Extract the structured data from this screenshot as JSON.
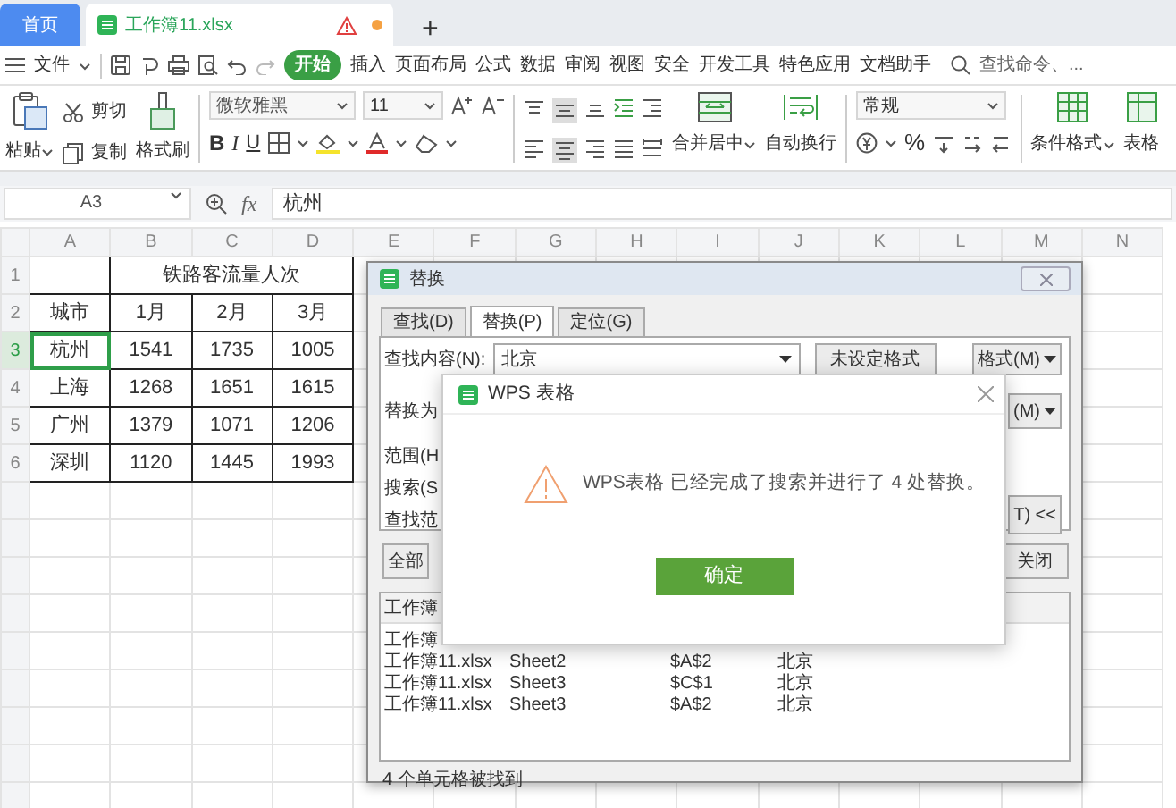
{
  "tabs": [
    {
      "label": "首页",
      "kind": "home",
      "selected": false
    },
    {
      "label": "工作簿11.xlsx",
      "kind": "document",
      "selected": true,
      "unsaved": true
    }
  ],
  "new_tab_label": "+",
  "menu": {
    "file": "文件",
    "items": [
      {
        "label": "开始",
        "selected": true
      },
      {
        "label": "插入",
        "selected": false
      },
      {
        "label": "页面布局",
        "selected": false
      },
      {
        "label": "公式",
        "selected": false
      },
      {
        "label": "数据",
        "selected": false
      },
      {
        "label": "审阅",
        "selected": false
      },
      {
        "label": "视图",
        "selected": false
      },
      {
        "label": "安全",
        "selected": false
      },
      {
        "label": "开发工具",
        "selected": false
      },
      {
        "label": "特色应用",
        "selected": false
      },
      {
        "label": "文档助手",
        "selected": false
      }
    ],
    "search_label": "查找命令、..."
  },
  "ribbon": {
    "paste": "粘贴",
    "cut": "剪切",
    "copy": "复制",
    "format_painter": "格式刷",
    "font_name": "微软雅黑",
    "font_size": "11",
    "bold": "B",
    "italic": "I",
    "underline": "U",
    "merge": "合并居中",
    "wrap": "自动换行",
    "number_format": "常规",
    "percent": "%",
    "conditional_format": "条件格式",
    "table_format": "表格"
  },
  "formula_bar": {
    "name_box": "A3",
    "fx": "fx",
    "value": "杭州"
  },
  "sheet": {
    "columns": [
      "A",
      "B",
      "C",
      "D",
      "E",
      "F",
      "G",
      "H",
      "I",
      "J",
      "K",
      "L",
      "M",
      "N"
    ],
    "row_numbers": [
      "1",
      "2",
      "3",
      "4",
      "5",
      "6"
    ],
    "title": "铁路客流量人次",
    "header": [
      "城市",
      "1月",
      "2月",
      "3月"
    ],
    "rows": [
      {
        "cells": [
          {
            "text": "杭州",
            "selected": true
          },
          {
            "text": "1541",
            "selected": false
          },
          {
            "text": "1735",
            "selected": false
          },
          {
            "text": "1005",
            "selected": false
          }
        ]
      },
      {
        "cells": [
          {
            "text": "上海",
            "selected": false
          },
          {
            "text": "1268",
            "selected": false
          },
          {
            "text": "1651",
            "selected": false
          },
          {
            "text": "1615",
            "selected": false
          }
        ]
      },
      {
        "cells": [
          {
            "text": "广州",
            "selected": false
          },
          {
            "text": "1379",
            "selected": false
          },
          {
            "text": "1071",
            "selected": false
          },
          {
            "text": "1206",
            "selected": false
          }
        ]
      },
      {
        "cells": [
          {
            "text": "深圳",
            "selected": false
          },
          {
            "text": "1120",
            "selected": false
          },
          {
            "text": "1445",
            "selected": false
          },
          {
            "text": "1993",
            "selected": false
          }
        ]
      }
    ]
  },
  "find_dialog": {
    "title": "替换",
    "tabs": [
      {
        "label": "查找(D)",
        "selected": false
      },
      {
        "label": "替换(P)",
        "selected": true
      },
      {
        "label": "定位(G)",
        "selected": false
      }
    ],
    "find_label": "查找内容(N):",
    "find_value": "北京",
    "no_format_button": "未设定格式",
    "format_button": "格式(M)",
    "replace_label": "替换为",
    "replace_format_button": "(M)",
    "options": [
      "范围(H",
      "搜索(S",
      "查找范"
    ],
    "options_button": "T) <<",
    "replace_all_button": "全部",
    "close_button": "关闭",
    "results_header": "工作簿",
    "results": [
      [
        "工作簿"
      ],
      [
        "工作簿11.xlsx",
        "Sheet2",
        "$A$2",
        "北京"
      ],
      [
        "工作簿11.xlsx",
        "Sheet3",
        "$C$1",
        "北京"
      ],
      [
        "工作簿11.xlsx",
        "Sheet3",
        "$A$2",
        "北京"
      ]
    ],
    "status": "4 个单元格被找到"
  },
  "message_dialog": {
    "title": "WPS 表格",
    "message": "WPS表格 已经完成了搜索并进行了 4 处替换。",
    "ok_button": "确定"
  }
}
